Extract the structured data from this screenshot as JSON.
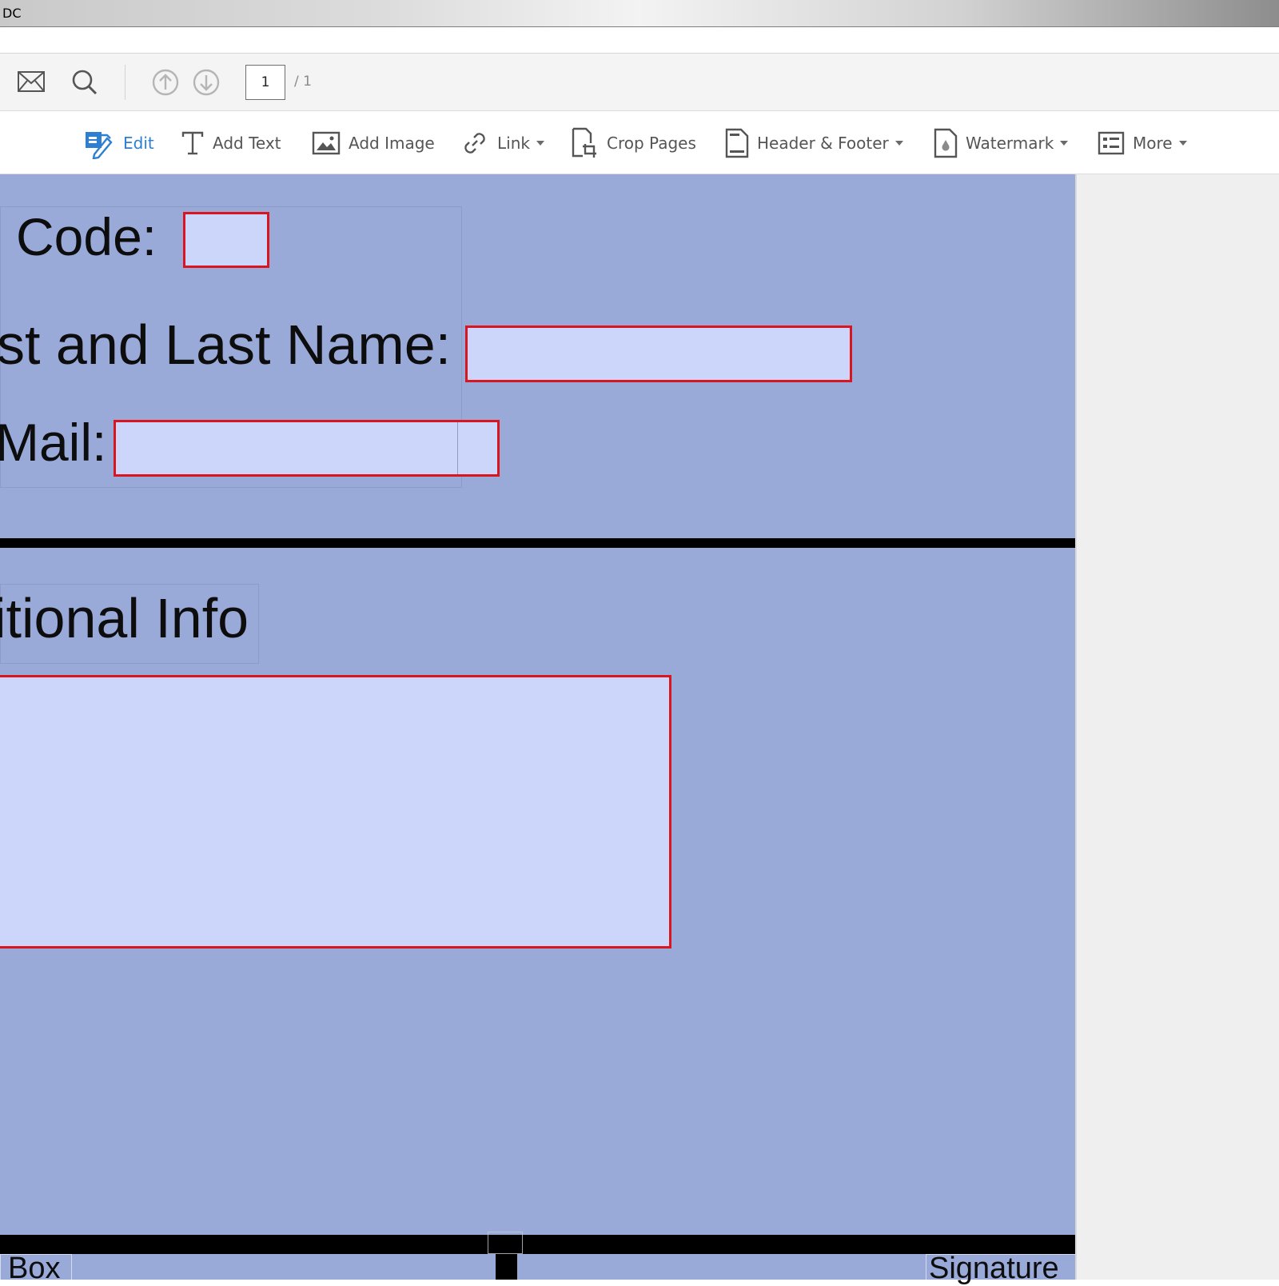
{
  "window": {
    "title": "DC"
  },
  "nav_toolbar": {
    "current_page": "1",
    "total_pages": "/ 1"
  },
  "edit_toolbar": {
    "tools": [
      {
        "label": "Edit",
        "icon": "edit-icon",
        "active": true
      },
      {
        "label": "Add Text",
        "icon": "add-text-icon"
      },
      {
        "label": "Add Image",
        "icon": "add-image-icon"
      },
      {
        "label": "Link",
        "icon": "link-icon",
        "dropdown": true
      },
      {
        "label": "Crop Pages",
        "icon": "crop-pages-icon"
      },
      {
        "label": "Header & Footer",
        "icon": "header-footer-icon",
        "dropdown": true
      },
      {
        "label": "Watermark",
        "icon": "watermark-icon",
        "dropdown": true
      },
      {
        "label": "More",
        "icon": "more-icon",
        "dropdown": true
      }
    ],
    "active_color": "#2d7fd3"
  },
  "document": {
    "background_color": "#99a9d8",
    "field_fill_color": "#ccd6fb",
    "field_border_color": "#d9161f",
    "labels": {
      "code": "Code:",
      "name": "st and Last Name:",
      "email": "Mail:",
      "additional_info": "itional Info",
      "box": "Box",
      "signature": "Signature"
    },
    "fields": {
      "code": "",
      "name": "",
      "email": "",
      "additional_info": ""
    }
  }
}
